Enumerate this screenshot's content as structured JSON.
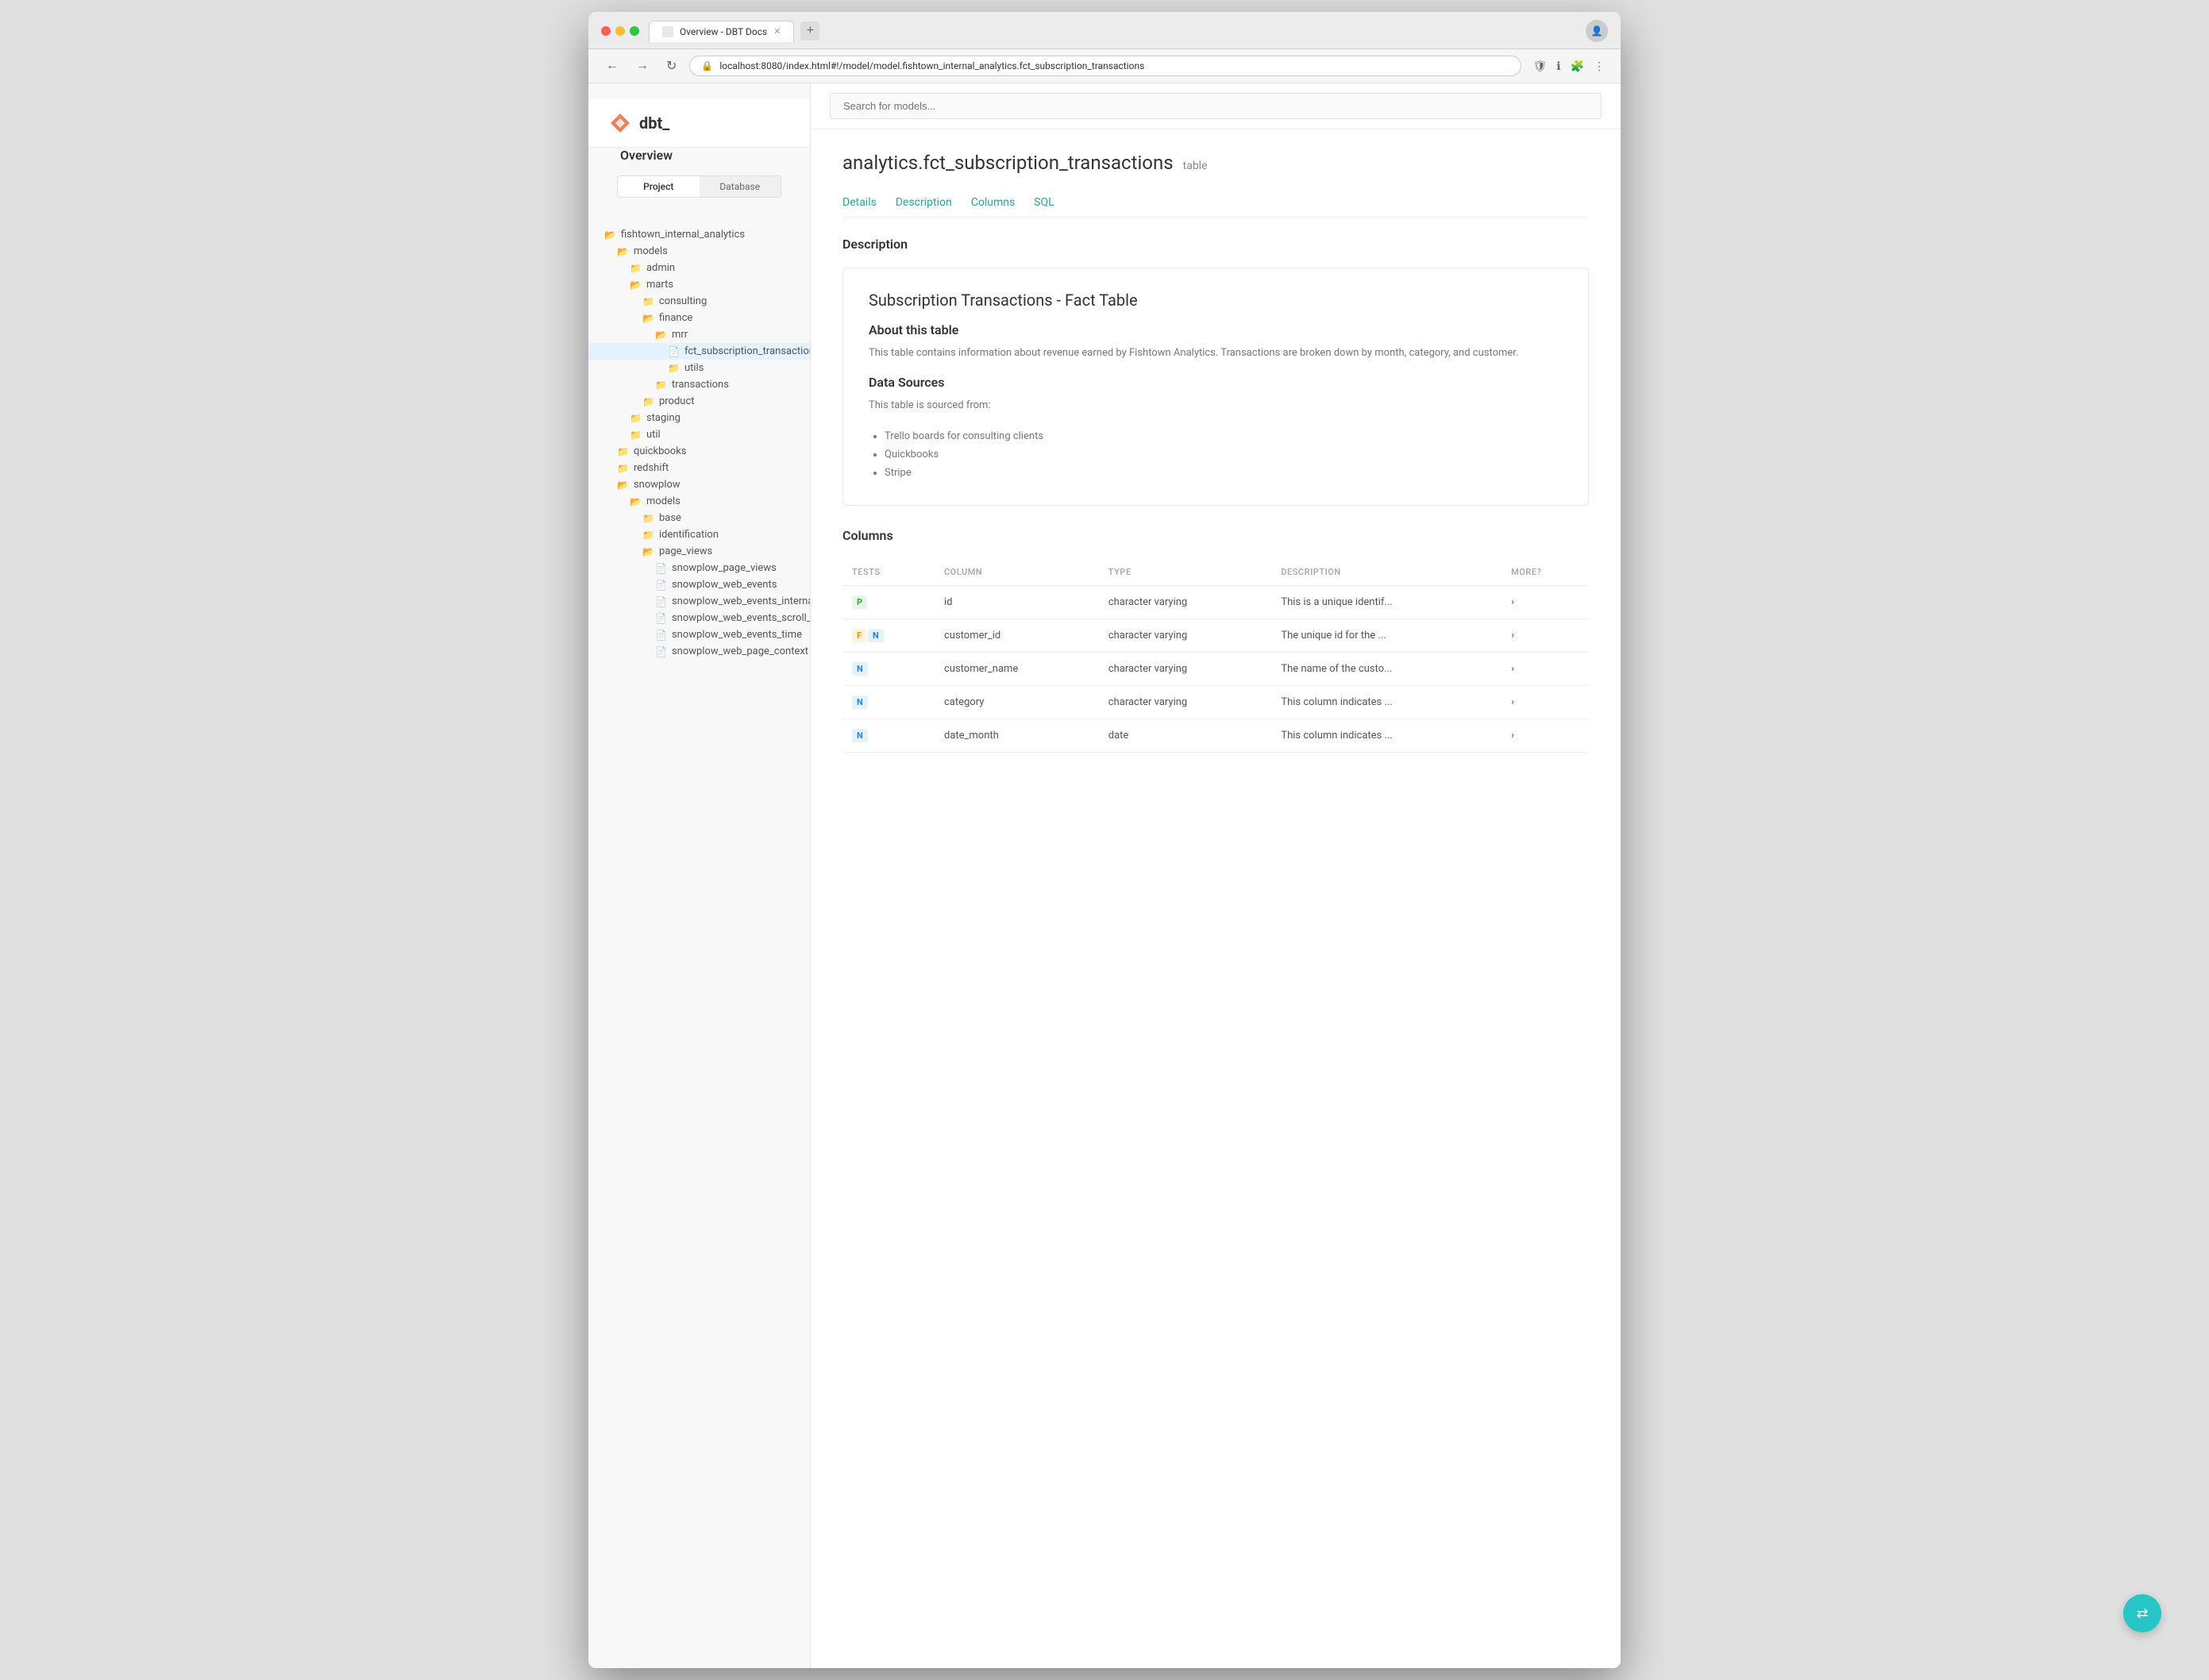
{
  "browser": {
    "tab_title": "Overview - DBT Docs",
    "url": "localhost:8080/index.html#!/model/model.fishtown_internal_analytics.fct_subscription_transactions",
    "nav_back": "←",
    "nav_forward": "→",
    "nav_refresh": "↻"
  },
  "app": {
    "logo_text": "dbt_",
    "search_placeholder": "Search for models..."
  },
  "sidebar": {
    "header": "Overview",
    "tabs": [
      "Project",
      "Database"
    ],
    "tree": [
      {
        "level": 1,
        "type": "folder-open",
        "label": "fishtown_internal_analytics"
      },
      {
        "level": 2,
        "type": "folder-open",
        "label": "models"
      },
      {
        "level": 3,
        "type": "folder",
        "label": "admin"
      },
      {
        "level": 3,
        "type": "folder-open",
        "label": "marts"
      },
      {
        "level": 4,
        "type": "folder",
        "label": "consulting"
      },
      {
        "level": 4,
        "type": "folder-open",
        "label": "finance"
      },
      {
        "level": 5,
        "type": "folder-open",
        "label": "mrr"
      },
      {
        "level": 6,
        "type": "file",
        "label": "fct_subscription_transactions",
        "active": true
      },
      {
        "level": 6,
        "type": "folder",
        "label": "utils"
      },
      {
        "level": 5,
        "type": "folder",
        "label": "transactions"
      },
      {
        "level": 4,
        "type": "folder",
        "label": "product"
      },
      {
        "level": 3,
        "type": "folder",
        "label": "staging"
      },
      {
        "level": 3,
        "type": "folder",
        "label": "util"
      },
      {
        "level": 2,
        "type": "folder",
        "label": "quickbooks"
      },
      {
        "level": 2,
        "type": "folder",
        "label": "redshift"
      },
      {
        "level": 2,
        "type": "folder-open",
        "label": "snowplow"
      },
      {
        "level": 3,
        "type": "folder-open",
        "label": "models"
      },
      {
        "level": 4,
        "type": "folder",
        "label": "base"
      },
      {
        "level": 4,
        "type": "folder",
        "label": "identification"
      },
      {
        "level": 4,
        "type": "folder-open",
        "label": "page_views"
      },
      {
        "level": 5,
        "type": "file",
        "label": "snowplow_page_views"
      },
      {
        "level": 5,
        "type": "file",
        "label": "snowplow_web_events"
      },
      {
        "level": 5,
        "type": "file",
        "label": "snowplow_web_events_internal_fixed"
      },
      {
        "level": 5,
        "type": "file",
        "label": "snowplow_web_events_scroll_depth"
      },
      {
        "level": 5,
        "type": "file",
        "label": "snowplow_web_events_time"
      },
      {
        "level": 5,
        "type": "file",
        "label": "snowplow_web_page_context"
      }
    ]
  },
  "page": {
    "title": "analytics.fct_subscription_transactions",
    "badge": "table",
    "tabs": [
      "Details",
      "Description",
      "Columns",
      "SQL"
    ],
    "section_heading": "Description",
    "description": {
      "title": "Subscription Transactions - Fact Table",
      "about_heading": "About this table",
      "about_text": "This table contains information about revenue earned by Fishtown Analytics. Transactions are broken down by month, category, and customer.",
      "sources_heading": "Data Sources",
      "sources_intro": "This table is sourced from:",
      "sources_list": [
        "Trello boards for consulting clients",
        "Quickbooks",
        "Stripe"
      ]
    },
    "columns": {
      "heading": "Columns",
      "headers": [
        "TESTS",
        "COLUMN",
        "TYPE",
        "DESCRIPTION",
        "MORE?"
      ],
      "rows": [
        {
          "tests": [
            {
              "label": "P",
              "type": "p"
            }
          ],
          "column": "id",
          "type": "character varying",
          "description": "This is a unique identif...",
          "more": "›"
        },
        {
          "tests": [
            {
              "label": "F",
              "type": "f"
            },
            {
              "label": "N",
              "type": "n"
            }
          ],
          "column": "customer_id",
          "type": "character varying",
          "description": "The unique id for the ...",
          "more": "›"
        },
        {
          "tests": [
            {
              "label": "N",
              "type": "n"
            }
          ],
          "column": "customer_name",
          "type": "character varying",
          "description": "The name of the custo...",
          "more": "›"
        },
        {
          "tests": [
            {
              "label": "N",
              "type": "n"
            }
          ],
          "column": "category",
          "type": "character varying",
          "description": "This column indicates ...",
          "more": "›"
        },
        {
          "tests": [
            {
              "label": "N",
              "type": "n"
            }
          ],
          "column": "date_month",
          "type": "date",
          "description": "This column indicates ...",
          "more": "›"
        }
      ]
    }
  },
  "fab": {
    "icon": "⇄"
  }
}
